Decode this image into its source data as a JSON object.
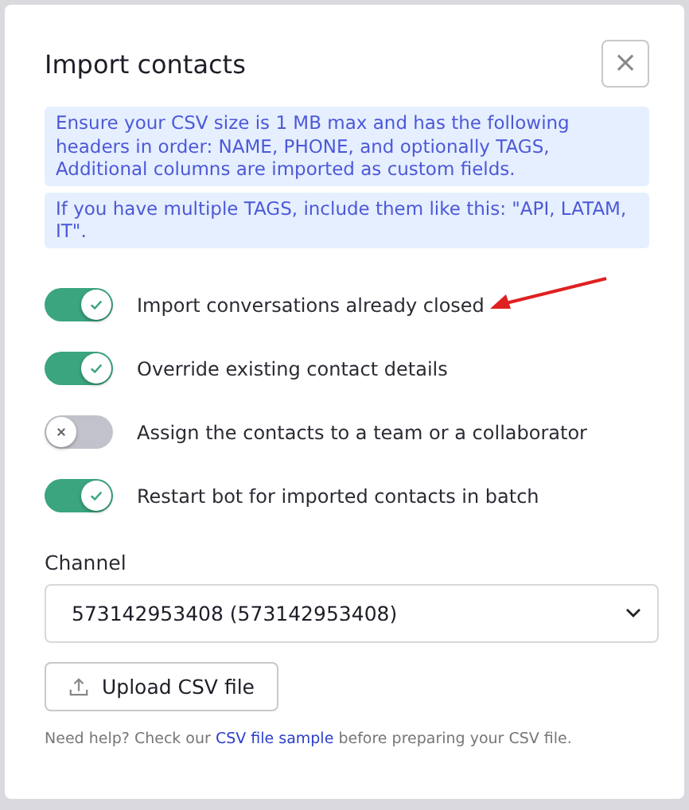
{
  "dialog": {
    "title": "Import contacts",
    "close_label": "×"
  },
  "notices": [
    "Ensure your CSV size is 1 MB max and has the following headers in order: NAME, PHONE, and optionally TAGS, Additional columns are imported as custom fields.",
    "If you have multiple TAGS, include them like this: \"API, LATAM, IT\"."
  ],
  "options": [
    {
      "label": "Import conversations already closed",
      "on": true
    },
    {
      "label": "Override existing contact details",
      "on": true
    },
    {
      "label": "Assign the contacts to a team or a collaborator",
      "on": false
    },
    {
      "label": "Restart bot for imported contacts in batch",
      "on": true
    }
  ],
  "channel": {
    "label": "Channel",
    "value": "573142953408 (573142953408)"
  },
  "upload_button": "Upload CSV file",
  "help": {
    "before": "Need help? Check our ",
    "link": "CSV file sample",
    "after": " before preparing your CSV file."
  }
}
